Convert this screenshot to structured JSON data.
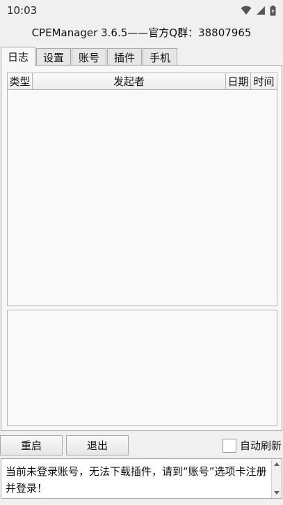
{
  "status_bar": {
    "time": "10:03",
    "icons": [
      "wifi-icon",
      "signal-icon",
      "battery-icon"
    ]
  },
  "window": {
    "title": "CPEManager 3.6.5——官方Q群：38807965"
  },
  "tabs": [
    {
      "label": "日志",
      "active": true
    },
    {
      "label": "设置",
      "active": false
    },
    {
      "label": "账号",
      "active": false
    },
    {
      "label": "插件",
      "active": false
    },
    {
      "label": "手机",
      "active": false
    }
  ],
  "log_table": {
    "columns": [
      "类型",
      "发起者",
      "日期",
      "时间"
    ],
    "rows": []
  },
  "bottom_bar": {
    "restart_label": "重启",
    "exit_label": "退出",
    "auto_refresh_label": "自动刷新",
    "auto_refresh_checked": false
  },
  "message": {
    "text": "当前未登录账号，无法下载插件，请到“账号”选项卡注册并登录！"
  },
  "colors": {
    "background": "#f0f0f0",
    "border": "#a8a8a8",
    "panel": "#f7f7f7"
  }
}
